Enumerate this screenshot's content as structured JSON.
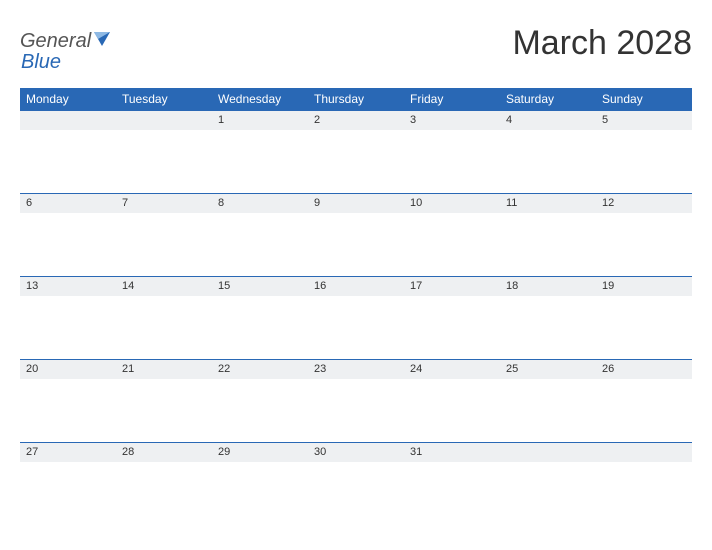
{
  "brand": {
    "word1": "General",
    "word2": "Blue"
  },
  "title": "March 2028",
  "day_headers": [
    "Monday",
    "Tuesday",
    "Wednesday",
    "Thursday",
    "Friday",
    "Saturday",
    "Sunday"
  ],
  "weeks": [
    [
      "",
      "",
      "1",
      "2",
      "3",
      "4",
      "5"
    ],
    [
      "6",
      "7",
      "8",
      "9",
      "10",
      "11",
      "12"
    ],
    [
      "13",
      "14",
      "15",
      "16",
      "17",
      "18",
      "19"
    ],
    [
      "20",
      "21",
      "22",
      "23",
      "24",
      "25",
      "26"
    ],
    [
      "27",
      "28",
      "29",
      "30",
      "31",
      "",
      ""
    ]
  ],
  "colors": {
    "accent": "#2968b5",
    "row_bg": "#eef0f2"
  }
}
